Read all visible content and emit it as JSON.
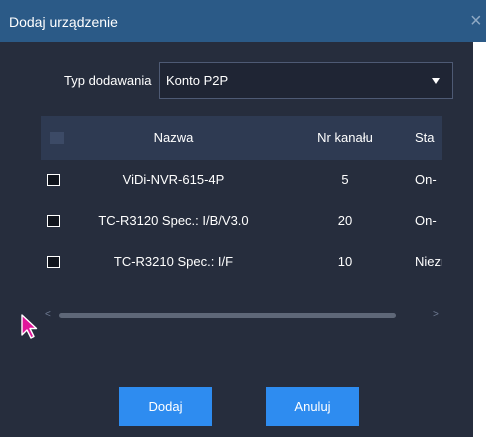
{
  "dialog": {
    "title": "Dodaj urządzenie",
    "close_glyph": "×"
  },
  "form": {
    "type_label": "Typ dodawania",
    "type_value": "Konto P2P"
  },
  "table": {
    "headers": [
      "Nazwa",
      "Nr kanału",
      "Sta"
    ],
    "rows": [
      {
        "name": "ViDi-NVR-615-4P",
        "channels": "5",
        "status": "On-",
        "checked": false
      },
      {
        "name": "TC-R3120 Spec.: I/B/V3.0",
        "channels": "20",
        "status": "On-",
        "checked": false
      },
      {
        "name": "TC-R3210 Spec.: I/F",
        "channels": "10",
        "status": "Niezr",
        "checked": false
      }
    ],
    "scroll_left": "<",
    "scroll_right": ">"
  },
  "buttons": {
    "add": "Dodaj",
    "cancel": "Anuluj"
  },
  "colors": {
    "titlebar": "#2b5a87",
    "background": "#262d3d",
    "header_row": "#2e3a52",
    "accent": "#2e8cf0",
    "cursor": "#e0159a"
  },
  "icons": {
    "close": "close-icon",
    "dropdown": "caret-down-icon",
    "cursor": "mouse-pointer-icon"
  }
}
